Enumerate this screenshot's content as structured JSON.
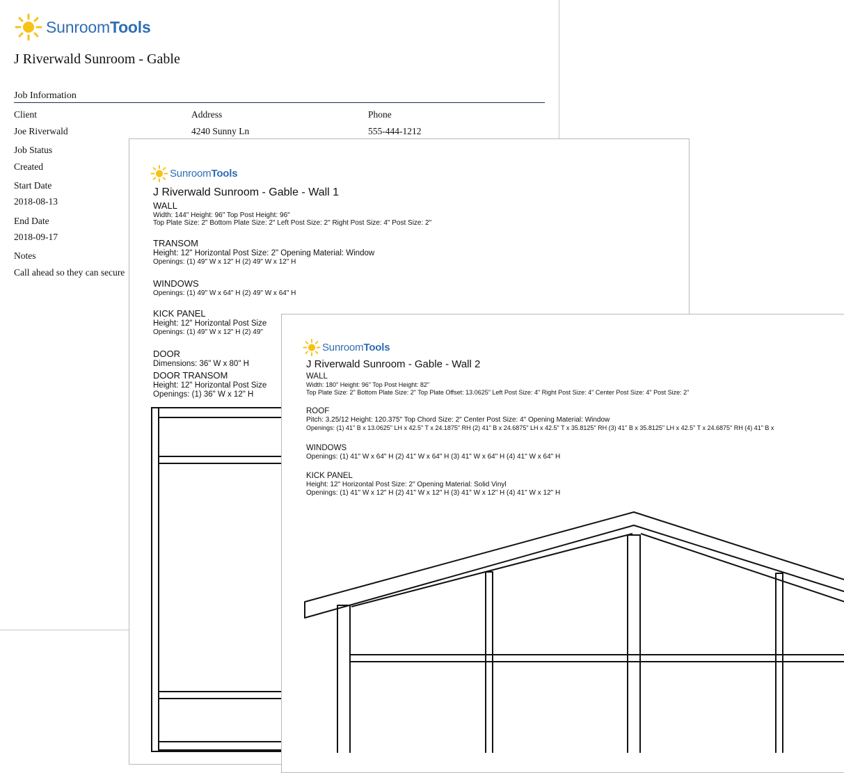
{
  "brand": {
    "name_light": "Sunroom",
    "name_bold": "Tools",
    "sun_color": "#f5c318",
    "text_color": "#2f6db3"
  },
  "sheet1": {
    "title": "J Riverwald Sunroom - Gable",
    "section_title": "Job Information",
    "client_label": "Client",
    "client_value": "Joe Riverwald",
    "address_label": "Address",
    "address_value": "4240 Sunny Ln",
    "phone_label": "Phone",
    "phone_value": "555-444-1212",
    "status_label": "Job Status",
    "status_value": "Created",
    "start_label": "Start Date",
    "start_value": "2018-08-13",
    "end_label": "End Date",
    "end_value": "2018-09-17",
    "notes_label": "Notes",
    "notes_value": "Call ahead so they can secure"
  },
  "sheet2": {
    "title": "J Riverwald Sunroom - Gable - Wall 1",
    "wall": {
      "heading": "WALL",
      "line1": "Width: 144\"   Height: 96\"   Top Post Height: 96\"",
      "line2": "Top Plate Size: 2\"   Bottom Plate Size: 2\"   Left Post Size: 2\"   Right Post Size: 4\"   Post Size: 2\""
    },
    "transom": {
      "heading": "TRANSOM",
      "line1": "Height: 12\"   Horizontal Post Size: 2\"   Opening Material: Window",
      "line2": "Openings: (1) 49\" W x 12\" H   (2) 49\" W x 12\" H"
    },
    "windows": {
      "heading": "WINDOWS",
      "line1": "Openings: (1) 49\" W x 64\" H   (2) 49\" W x 64\" H"
    },
    "kick_panel": {
      "heading": "KICK PANEL",
      "line1": "Height: 12\"   Horizontal Post Size",
      "line2": "Openings: (1) 49\" W x 12\" H   (2) 49\""
    },
    "door": {
      "heading": "DOOR",
      "line1": "Dimensions: 36\" W x 80\" H"
    },
    "door_transom": {
      "heading": "DOOR TRANSOM",
      "line1": "Height: 12\"   Horizontal Post Size",
      "line2": "Openings: (1) 36\" W x 12\" H"
    }
  },
  "sheet3": {
    "title": "J Riverwald Sunroom - Gable - Wall 2",
    "wall": {
      "heading": "WALL",
      "line1": "Width: 180\"   Height: 96\"   Top Post Height: 82\"",
      "line2": "Top Plate Size: 2\"   Bottom Plate Size: 2\"   Top Plate Offset: 13.0625\"   Left Post Size: 4\"   Right Post Size: 4\"   Center Post Size: 4\"   Post Size: 2\""
    },
    "roof": {
      "heading": "ROOF",
      "line1": "Pitch: 3.25/12   Height: 120.375\"   Top Chord Size: 2\"   Center Post Size: 4\"   Opening Material: Window",
      "line2": "Openings: (1) 41\" B x 13.0625\" LH x 42.5\" T x 24.1875\" RH   (2) 41\" B x 24.6875\" LH x 42.5\" T x 35.8125\" RH   (3) 41\" B x 35.8125\" LH x 42.5\" T x 24.6875\" RH   (4) 41\" B x"
    },
    "windows": {
      "heading": "WINDOWS",
      "line1": "Openings: (1) 41\" W x 64\" H   (2) 41\" W x 64\" H   (3) 41\" W x 64\" H   (4) 41\" W x 64\" H"
    },
    "kick_panel": {
      "heading": "KICK PANEL",
      "line1": "Height: 12\"   Horizontal Post Size: 2\"   Opening Material: Solid Vinyl",
      "line2": "Openings: (1) 41\" W x 12\" H   (2) 41\" W x 12\" H   (3) 41\" W x 12\" H   (4) 41\" W x 12\" H"
    }
  }
}
